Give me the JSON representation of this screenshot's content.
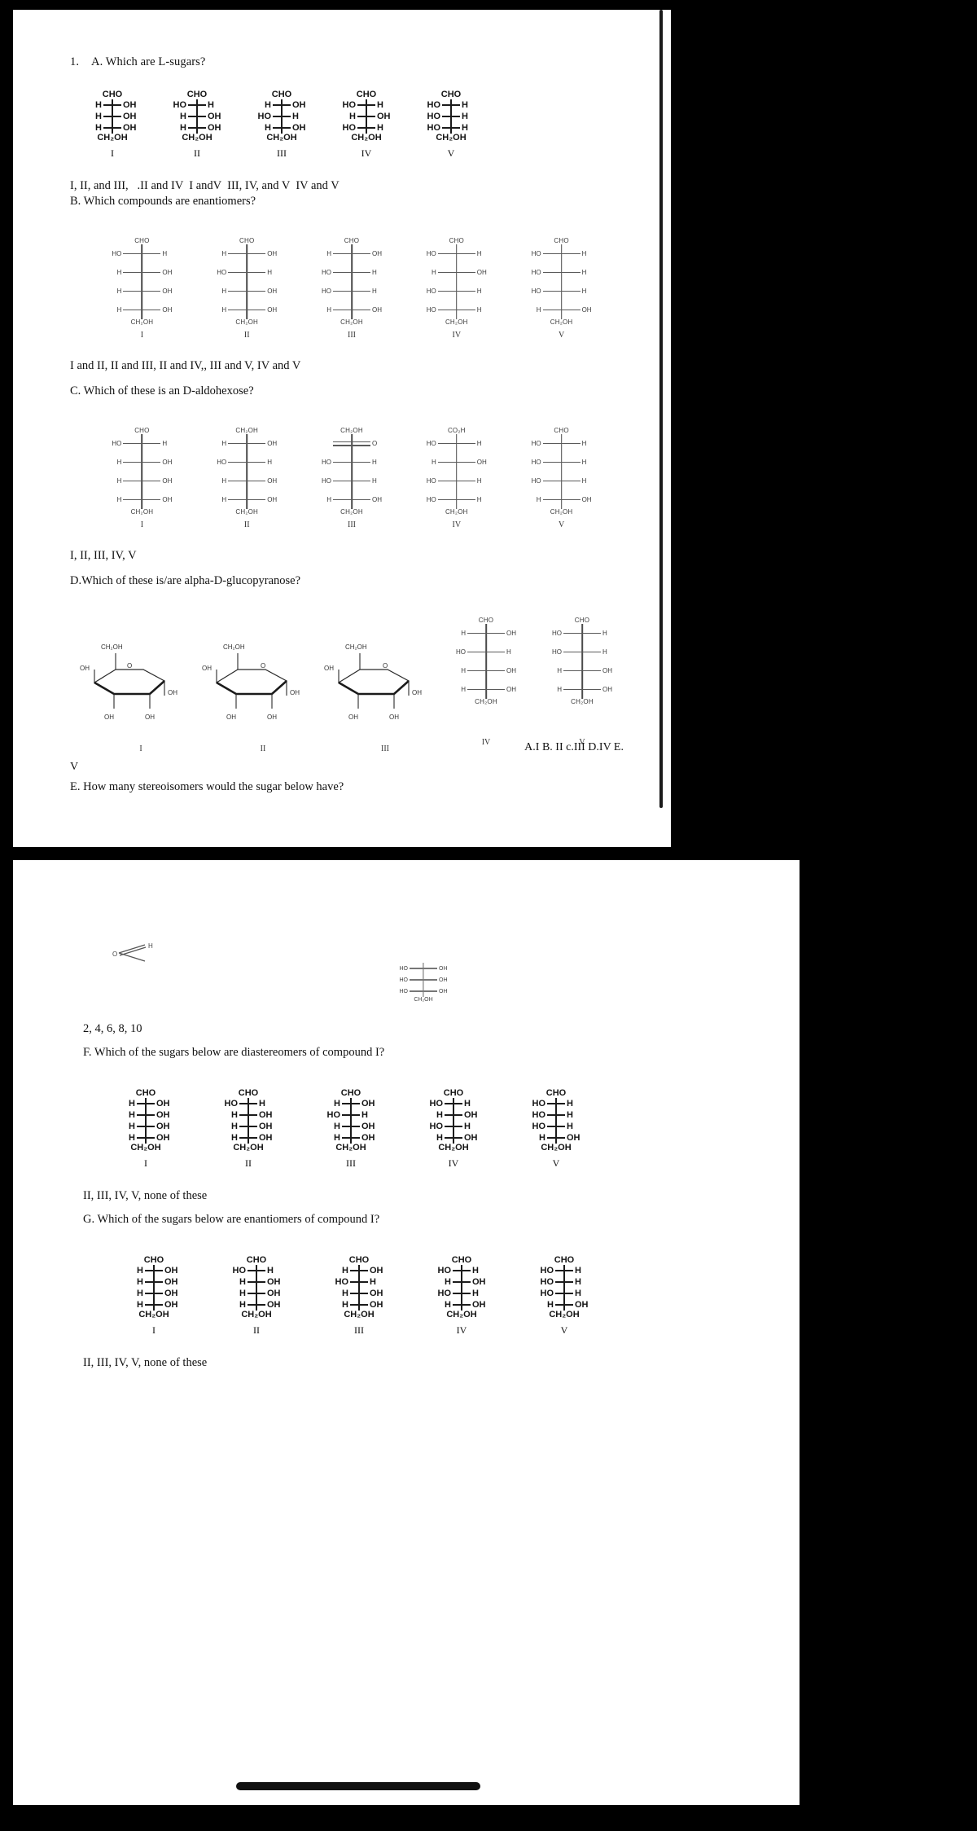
{
  "document": {
    "question_number": "1.",
    "sections": {
      "A": {
        "prompt": "A. Which are L-sugars?",
        "answers": "I, II, and III,   .II and IV  I andV  III, IV, and V  IV and V",
        "structures": [
          {
            "label": "I",
            "top": "CHO",
            "bottom": "CH₂OH",
            "rungs": [
              [
                "H",
                "OH"
              ],
              [
                "H",
                "OH"
              ],
              [
                "H",
                "OH"
              ]
            ]
          },
          {
            "label": "II",
            "top": "CHO",
            "bottom": "CH₂OH",
            "rungs": [
              [
                "HO",
                "H"
              ],
              [
                "H",
                "OH"
              ],
              [
                "H",
                "OH"
              ]
            ]
          },
          {
            "label": "III",
            "top": "CHO",
            "bottom": "CH₂OH",
            "rungs": [
              [
                "H",
                "OH"
              ],
              [
                "HO",
                "H"
              ],
              [
                "H",
                "OH"
              ]
            ]
          },
          {
            "label": "IV",
            "top": "CHO",
            "bottom": "CH₂OH",
            "rungs": [
              [
                "HO",
                "H"
              ],
              [
                "H",
                "OH"
              ],
              [
                "HO",
                "H"
              ]
            ]
          },
          {
            "label": "V",
            "top": "CHO",
            "bottom": "CH₂OH",
            "rungs": [
              [
                "HO",
                "H"
              ],
              [
                "HO",
                "H"
              ],
              [
                "HO",
                "H"
              ]
            ]
          }
        ]
      },
      "B": {
        "prompt": "B. Which compounds are enantiomers?",
        "answers": "I and II, II and III, II and IV,, III and V, IV and V",
        "structures": [
          {
            "label": "I",
            "top": "CHO",
            "bottom": "CH₂OH",
            "rungs": [
              [
                "HO",
                "H"
              ],
              [
                "H",
                "OH"
              ],
              [
                "H",
                "OH"
              ],
              [
                "H",
                "OH"
              ]
            ]
          },
          {
            "label": "II",
            "top": "CHO",
            "bottom": "CH₂OH",
            "rungs": [
              [
                "H",
                "OH"
              ],
              [
                "HO",
                "H"
              ],
              [
                "H",
                "OH"
              ],
              [
                "H",
                "OH"
              ]
            ]
          },
          {
            "label": "III",
            "top": "CHO",
            "bottom": "CH₂OH",
            "rungs": [
              [
                "H",
                "OH"
              ],
              [
                "HO",
                "H"
              ],
              [
                "HO",
                "H"
              ],
              [
                "H",
                "OH"
              ]
            ]
          },
          {
            "label": "IV",
            "top": "CHO",
            "bottom": "CH₂OH",
            "rungs": [
              [
                "HO",
                "H"
              ],
              [
                "H",
                "OH"
              ],
              [
                "HO",
                "H"
              ],
              [
                "HO",
                "H"
              ]
            ]
          },
          {
            "label": "V",
            "top": "CHO",
            "bottom": "CH₂OH",
            "rungs": [
              [
                "HO",
                "H"
              ],
              [
                "HO",
                "H"
              ],
              [
                "HO",
                "H"
              ],
              [
                "H",
                "OH"
              ]
            ]
          }
        ]
      },
      "C": {
        "prompt": "C. Which of these is an D-aldohexose?",
        "answers": "I, II, III, IV, V",
        "structures": [
          {
            "label": "I",
            "top": "CHO",
            "bottom": "CH₂OH",
            "rungs": [
              [
                "HO",
                "H"
              ],
              [
                "H",
                "OH"
              ],
              [
                "H",
                "OH"
              ],
              [
                "H",
                "OH"
              ]
            ]
          },
          {
            "label": "II",
            "top": "CH₂OH",
            "bottom": "CH₂OH",
            "rungs": [
              [
                "H",
                "OH"
              ],
              [
                "HO",
                "H"
              ],
              [
                "H",
                "OH"
              ],
              [
                "H",
                "OH"
              ]
            ]
          },
          {
            "label": "III",
            "top": "CH₂OH",
            "bottom": "CH₂OH",
            "rungs": [
              [
                "",
                "O"
              ],
              [
                "HO",
                "H"
              ],
              [
                "HO",
                "H"
              ],
              [
                "H",
                "OH"
              ]
            ],
            "ketone_row": 0
          },
          {
            "label": "IV",
            "top": "CO₂H",
            "bottom": "CH₂OH",
            "rungs": [
              [
                "HO",
                "H"
              ],
              [
                "H",
                "OH"
              ],
              [
                "HO",
                "H"
              ],
              [
                "HO",
                "H"
              ]
            ]
          },
          {
            "label": "V",
            "top": "CHO",
            "bottom": "CH₂OH",
            "rungs": [
              [
                "HO",
                "H"
              ],
              [
                "HO",
                "H"
              ],
              [
                "HO",
                "H"
              ],
              [
                "H",
                "OH"
              ]
            ]
          }
        ]
      },
      "D": {
        "prompt": "D.Which of these is/are alpha-D-glucopyranose?",
        "ring_labels": [
          "I",
          "II",
          "III"
        ],
        "rings": [
          {
            "label": "I",
            "caps": [
              "CH₂OH",
              "OH",
              "OH",
              "OH",
              "OH"
            ]
          },
          {
            "label": "II",
            "caps": [
              "CH₂OH",
              "OH",
              "OH",
              "OH",
              "OH"
            ]
          },
          {
            "label": "III",
            "caps": [
              "CH₂OH",
              "OH",
              "OH",
              "OH",
              "OH"
            ]
          }
        ],
        "structures": [
          {
            "label": "IV",
            "top": "CHO",
            "bottom": "CH₂OH",
            "rungs": [
              [
                "H",
                "OH"
              ],
              [
                "HO",
                "H"
              ],
              [
                "H",
                "OH"
              ],
              [
                "H",
                "OH"
              ]
            ]
          },
          {
            "label": "V",
            "top": "CHO",
            "bottom": "CH₂OH",
            "rungs": [
              [
                "HO",
                "H"
              ],
              [
                "HO",
                "H"
              ],
              [
                "H",
                "OH"
              ],
              [
                "H",
                "OH"
              ]
            ]
          }
        ],
        "answers_right": "A.I B. II c.III D.IV E.",
        "answers_tail": "V"
      },
      "E": {
        "prompt": "E. How many stereoisomers would the sugar below have?",
        "answers": "2, 4, 6, 8, 10",
        "structure": {
          "top_left": "O",
          "top_right": "H",
          "bottom": "CH₂OH",
          "rungs": [
            [
              "HO",
              "OH"
            ],
            [
              "HO",
              "OH"
            ],
            [
              "HO",
              "OH"
            ]
          ]
        }
      },
      "F": {
        "prompt": "F. Which of the sugars below are diastereomers of compound I?",
        "answers": "II, III, IV, V, none of these",
        "structures": [
          {
            "label": "I",
            "top": "CHO",
            "bottom": "CH₂OH",
            "rungs": [
              [
                "H",
                "OH"
              ],
              [
                "H",
                "OH"
              ],
              [
                "H",
                "OH"
              ],
              [
                "H",
                "OH"
              ]
            ]
          },
          {
            "label": "II",
            "top": "CHO",
            "bottom": "CH₂OH",
            "rungs": [
              [
                "HO",
                "H"
              ],
              [
                "H",
                "OH"
              ],
              [
                "H",
                "OH"
              ],
              [
                "H",
                "OH"
              ]
            ]
          },
          {
            "label": "III",
            "top": "CHO",
            "bottom": "CH₂OH",
            "rungs": [
              [
                "H",
                "OH"
              ],
              [
                "HO",
                "H"
              ],
              [
                "H",
                "OH"
              ],
              [
                "H",
                "OH"
              ]
            ]
          },
          {
            "label": "IV",
            "top": "CHO",
            "bottom": "CH₂OH",
            "rungs": [
              [
                "HO",
                "H"
              ],
              [
                "H",
                "OH"
              ],
              [
                "HO",
                "H"
              ],
              [
                "H",
                "OH"
              ]
            ]
          },
          {
            "label": "V",
            "top": "CHO",
            "bottom": "CH₂OH",
            "rungs": [
              [
                "HO",
                "H"
              ],
              [
                "HO",
                "H"
              ],
              [
                "HO",
                "H"
              ],
              [
                "H",
                "OH"
              ]
            ]
          }
        ]
      },
      "G": {
        "prompt": "G. Which of the sugars below are enantiomers of compound I?",
        "answers": "II, III, IV, V, none of these",
        "structures": [
          {
            "label": "I",
            "top": "CHO",
            "bottom": "CH₂OH",
            "rungs": [
              [
                "H",
                "OH"
              ],
              [
                "H",
                "OH"
              ],
              [
                "H",
                "OH"
              ],
              [
                "H",
                "OH"
              ]
            ]
          },
          {
            "label": "II",
            "top": "CHO",
            "bottom": "CH₂OH",
            "rungs": [
              [
                "HO",
                "H"
              ],
              [
                "H",
                "OH"
              ],
              [
                "H",
                "OH"
              ],
              [
                "H",
                "OH"
              ]
            ]
          },
          {
            "label": "III",
            "top": "CHO",
            "bottom": "CH₂OH",
            "rungs": [
              [
                "H",
                "OH"
              ],
              [
                "HO",
                "H"
              ],
              [
                "H",
                "OH"
              ],
              [
                "H",
                "OH"
              ]
            ]
          },
          {
            "label": "IV",
            "top": "CHO",
            "bottom": "CH₂OH",
            "rungs": [
              [
                "HO",
                "H"
              ],
              [
                "H",
                "OH"
              ],
              [
                "HO",
                "H"
              ],
              [
                "H",
                "OH"
              ]
            ]
          },
          {
            "label": "V",
            "top": "CHO",
            "bottom": "CH₂OH",
            "rungs": [
              [
                "HO",
                "H"
              ],
              [
                "HO",
                "H"
              ],
              [
                "HO",
                "H"
              ],
              [
                "H",
                "OH"
              ]
            ]
          }
        ]
      }
    }
  },
  "colors": {
    "background": "#000000",
    "page": "#ffffff",
    "ink": "#111111",
    "line_dark": "#1b1b1b",
    "line_gray": "#5a5a5a"
  }
}
